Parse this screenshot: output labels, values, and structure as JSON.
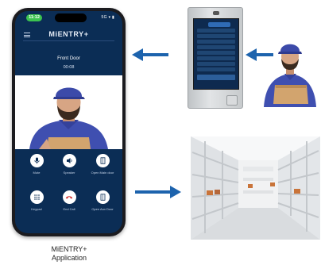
{
  "phone": {
    "status_time": "11:12",
    "status_right": "5G ▾ ▮",
    "brand": "MiENTRY+",
    "door_title": "Front Door",
    "timer": "00:08",
    "controls": [
      {
        "label": "Mute",
        "icon": "microphone-icon"
      },
      {
        "label": "Speaker",
        "icon": "speaker-icon"
      },
      {
        "label": "Open Main door",
        "icon": "door-icon"
      },
      {
        "label": "Keypad",
        "icon": "keypad-icon"
      },
      {
        "label": "End Call",
        "icon": "phone-hangup-icon"
      },
      {
        "label": "Open Aux Door",
        "icon": "door-icon"
      }
    ]
  },
  "caption": {
    "line1": "MiENTRY+",
    "line2": "Application"
  },
  "colors": {
    "phone_bg": "#0b2d55",
    "end_call": "#d32f2f",
    "arrow": "#1d63ad",
    "shirt": "#3f4fb0"
  }
}
